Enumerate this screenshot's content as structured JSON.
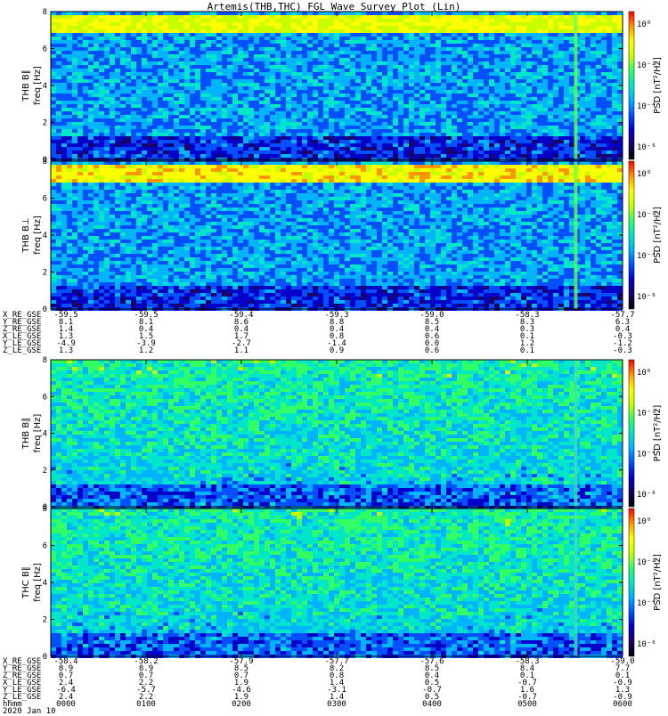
{
  "title": "Artemis(THB,THC) FGL Wave Survey Plot (Lin)",
  "chart_data": {
    "type": "heatmap",
    "colormap": [
      "#000000",
      "#1a0066",
      "#0000c8",
      "#0050ff",
      "#00b4ff",
      "#00e6c8",
      "#32ff64",
      "#c8ff00",
      "#ffff00",
      "#ff9600",
      "#ff0000"
    ],
    "panels": [
      {
        "probe": "THB",
        "component": "B_L",
        "ylabel": "freq [Hz]",
        "ylim": [
          0,
          8
        ],
        "yticks": [
          "0",
          "2",
          "4",
          "6",
          "8"
        ],
        "colorbar_label": "PSD [nT²/Hz]",
        "colorbar_ticks": [
          "10⁰",
          "10⁻²",
          "10⁻⁴",
          "10⁻⁶"
        ],
        "band_hz": [
          6.8,
          7.8
        ],
        "band_intensity": 0.65
      },
      {
        "probe": "THB",
        "component": "B⊥",
        "ylabel": "freq [Hz]",
        "ylim": [
          0,
          8
        ],
        "yticks": [
          "0",
          "2",
          "4",
          "6",
          "8"
        ],
        "colorbar_label": "PSD [nT²/Hz]",
        "colorbar_ticks": [
          "10⁰",
          "10⁻²",
          "10⁻⁴",
          "10⁻⁶"
        ],
        "band_hz": [
          6.8,
          7.8
        ],
        "band_intensity": 0.7
      },
      {
        "probe": "THB",
        "component": "B_L",
        "ylabel": "freq [Hz]",
        "ylim": [
          0,
          8
        ],
        "yticks": [
          "0",
          "2",
          "4",
          "6",
          "8"
        ],
        "colorbar_label": "PSD [nT²/Hz]",
        "colorbar_ticks": [
          "10⁰",
          "10⁻²",
          "10⁻⁴",
          "10⁻⁶"
        ],
        "band_hz": [
          0,
          0
        ],
        "band_intensity": 0.45
      },
      {
        "probe": "THC",
        "component": "B∥",
        "ylabel": "freq [Hz]",
        "ylim": [
          0,
          8
        ],
        "yticks": [
          "0",
          "2",
          "4",
          "6",
          "8"
        ],
        "colorbar_label": "PSD [nT²/Hz]",
        "colorbar_ticks": [
          "10⁰",
          "10⁻²",
          "10⁻⁴",
          "10⁻⁶"
        ],
        "band_hz": [
          0,
          0
        ],
        "band_intensity": 0.35
      }
    ],
    "panel_ylabels": [
      "THB B∥",
      "THB B⊥",
      "THB B∥",
      "THC B∥"
    ],
    "ephemeris_top": {
      "labels": [
        "X_RE_GSE",
        "Y_RE_GSE",
        "Z_RE_GSE",
        "X_LE_GSE",
        "Y_LE_GSE",
        "Z_LE_GSE"
      ],
      "columns": [
        [
          "-59.5",
          "8.1",
          "1.4",
          "1.3",
          "-4.9",
          "1.3"
        ],
        [
          "-59.5",
          "8.1",
          "0.4",
          "1.5",
          "-3.9",
          "1.2"
        ],
        [
          "-59.4",
          "8.6",
          "0.4",
          "1.7",
          "-2.7",
          "1.1"
        ],
        [
          "-59.3",
          "8.8",
          "0.4",
          "0.8",
          "-1.4",
          "0.9"
        ],
        [
          "-59.0",
          "8.5",
          "0.4",
          "0.6",
          "0.0",
          "0.6"
        ],
        [
          "-58.3",
          "8.3",
          "0.3",
          "0.1",
          "1.2",
          "0.1"
        ],
        [
          "-57.7",
          "6.3",
          "0.4",
          "-0.3",
          "-1.2",
          "-0.3"
        ]
      ]
    },
    "ephemeris_bottom": {
      "labels": [
        "X_RE_GSE",
        "Y_RE_GSE",
        "Z_RE_GSE",
        "X_LE_GSE",
        "Y_LE_GSE",
        "Z_LE_GSE",
        "hhmm",
        "2020 Jan 10"
      ],
      "columns": [
        [
          "-58.4",
          "8.9",
          "0.7",
          "2.4",
          "-6.4",
          "2.4",
          "0000"
        ],
        [
          "-58.2",
          "8.9",
          "0.7",
          "2.2",
          "-5.7",
          "2.2",
          "0100"
        ],
        [
          "-57.9",
          "8.5",
          "0.7",
          "1.9",
          "-4.6",
          "1.9",
          "0200"
        ],
        [
          "-57.7",
          "8.2",
          "0.8",
          "1.4",
          "-3.1",
          "1.4",
          "0300"
        ],
        [
          "-57.6",
          "8.5",
          "0.4",
          "0.5",
          "-0.7",
          "0.5",
          "0400"
        ],
        [
          "-58.3",
          "8.4",
          "0.1",
          "-0.7",
          "1.6",
          "-0.7",
          "0500"
        ],
        [
          "-59.0",
          "7.7",
          "0.1",
          "-0.9",
          "1.3",
          "-0.9",
          "0600"
        ]
      ]
    }
  }
}
